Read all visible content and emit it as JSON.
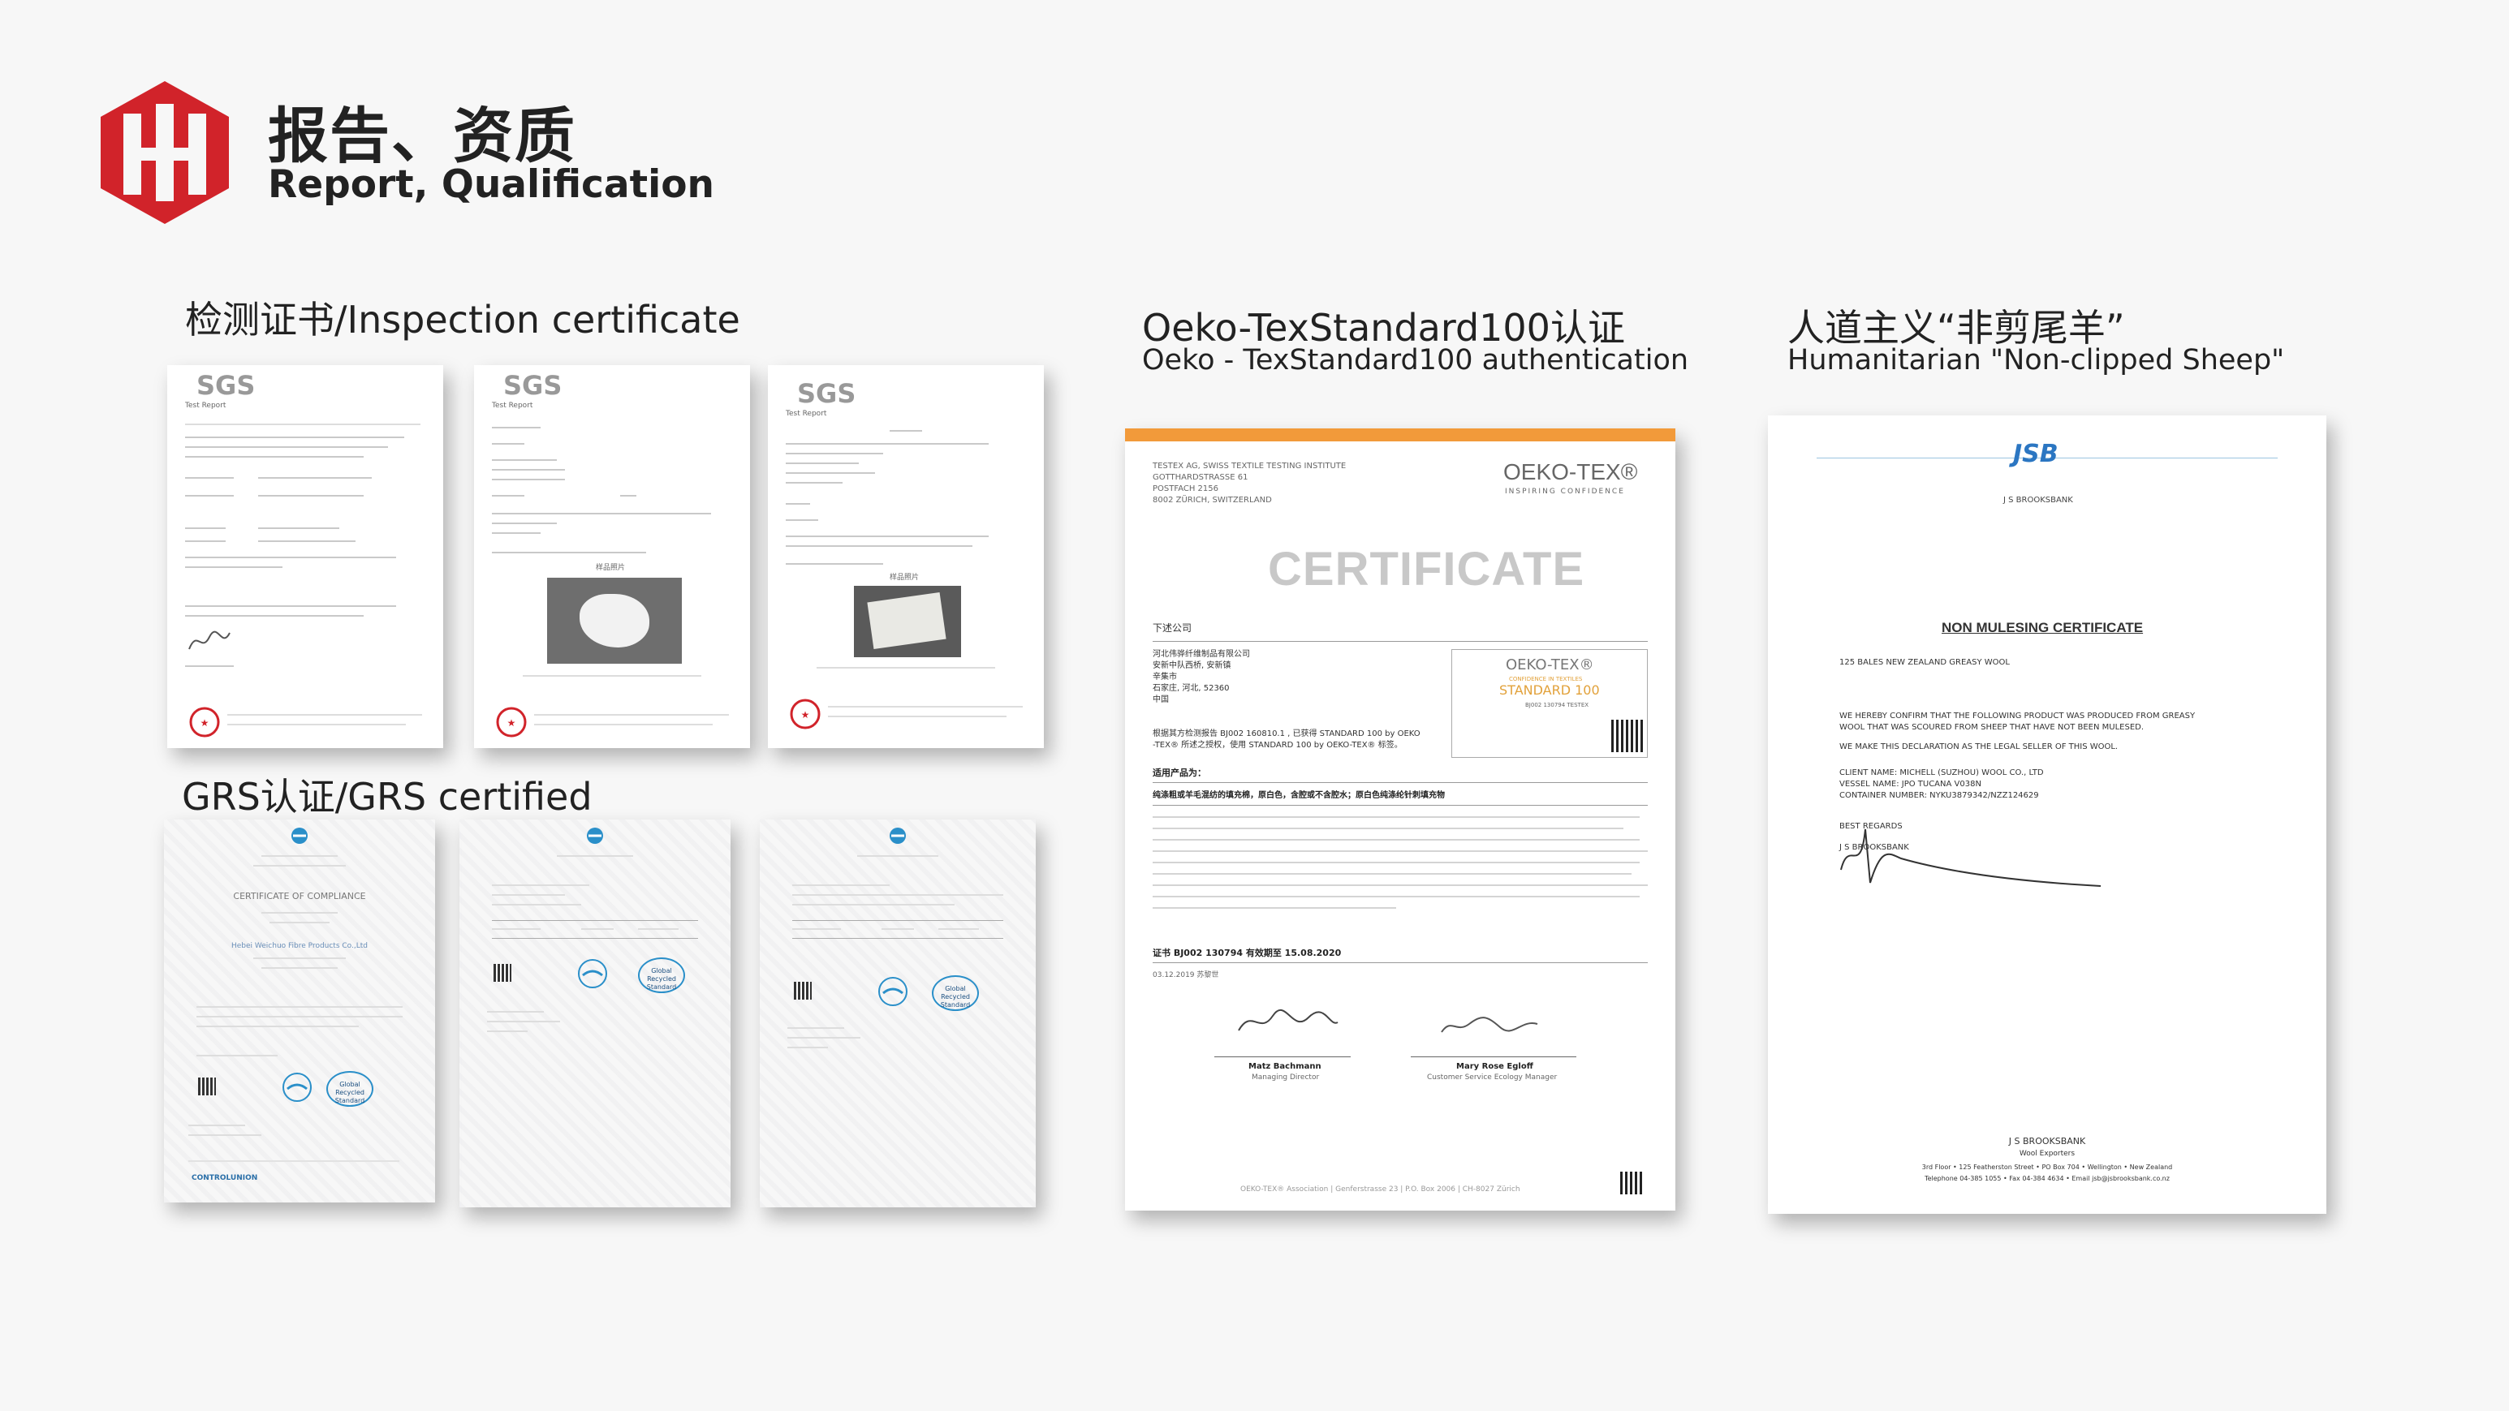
{
  "header": {
    "title_cn": "报告、资质",
    "title_en": "Report, Qualification",
    "brand_color": "#d1232a"
  },
  "sections": {
    "inspection": {
      "title": "检测证书/Inspection certificate"
    },
    "grs": {
      "title": "GRS认证/GRS certified"
    },
    "oeko": {
      "title": "Oeko-TexStandard100认证",
      "subtitle": "Oeko - TexStandard100 authentication"
    },
    "humanitarian": {
      "title": "人道主义“非剪尾羊”",
      "subtitle": "Humanitarian \"Non-clipped Sheep\""
    }
  },
  "docs": {
    "sgs": {
      "brand": "SGS",
      "report_label": "Test Report",
      "caption": "样品照片"
    },
    "grs": {
      "title": "CERTIFICATE OF COMPLIANCE",
      "company": "Hebei Weichuo Fibre Products Co.,Ltd",
      "gr_badge": "Global Recycled Standard",
      "footer_brand": "CONTROLUNION"
    },
    "oeko": {
      "lab_line1": "TESTEX AG, SWISS TEXTILE TESTING INSTITUTE",
      "lab_line2": "GOTTHARDSTRASSE 61",
      "lab_line3": "POSTFACH 2156",
      "lab_line4": "8002 ZÜRICH, SWITZERLAND",
      "brand": "OEKO-TEX®",
      "brand_sub": "INSPIRING CONFIDENCE",
      "heading": "CERTIFICATE",
      "issued_to": "下述公司",
      "company_1": "河北伟骅纤维制品有限公司",
      "company_2": "安新中队西桥, 安新镇",
      "company_3": "辛集市",
      "company_4": "石家庄, 河北, 52360",
      "company_5": "中国",
      "std_badge_top": "OEKO-TEX®",
      "std_badge_mid": "CONFIDENCE IN TEXTILES",
      "std_badge_main": "STANDARD 100",
      "std_badge_num": "BJ002 130794 TESTEX",
      "grant_1": "根据其方检测报告 BJ002 160810.1 , 已获得 STANDARD 100 by OEKO",
      "grant_2": "-TEX® 所述之授权，使用 STANDARD 100 by OEKO-TEX® 标签。",
      "product_label": "适用产品为：",
      "product": "纯涤粗或羊毛混纺的填充棉，原白色，含腔或不含腔水；原白色纯涤纶针刺填充物",
      "cert_no": "证书 BJ002 130794 有效期至 15.08.2020",
      "date": "03.12.2019 苏黎世",
      "signer1_name": "Matz Bachmann",
      "signer1_title": "Managing Director",
      "signer2_name": "Mary Rose Egloff",
      "signer2_title": "Customer Service Ecology Manager",
      "footer": "OEKO-TEX® Association | Genferstrasse 23 | P.O. Box 2006 | CH-8027 Zürich"
    },
    "jsb": {
      "logo": "JSB",
      "logo_sub": "J S BROOKSBANK",
      "title": "NON MULESING CERTIFICATE",
      "line1": "125 BALES NEW ZEALAND GREASY WOOL",
      "line2": "WE HEREBY CONFIRM THAT THE FOLLOWING PRODUCT WAS PRODUCED FROM GREASY",
      "line3": "WOOL THAT WAS  SCOURED FROM SHEEP THAT HAVE NOT BEEN MULESED.",
      "line4": "WE MAKE THIS DECLARATION AS THE LEGAL SELLER OF THIS WOOL.",
      "client": "CLIENT NAME:  MICHELL (SUZHOU) WOOL CO., LTD",
      "vessel": "VESSEL NAME:  JPO TUCANA V038N",
      "container": "CONTAINER NUMBER: NYKU3879342/NZZ124629",
      "regards": "BEST REGARDS",
      "signer": "J S BROOKSBANK",
      "footer1": "J S BROOKSBANK",
      "footer2": "Wool Exporters",
      "footer3": "3rd Floor • 125 Featherston Street • PO Box 704 • Wellington • New Zealand",
      "footer4": "Telephone 04-385 1055 • Fax 04-384 4634 • Email jsb@jsbrooksbank.co.nz"
    }
  }
}
